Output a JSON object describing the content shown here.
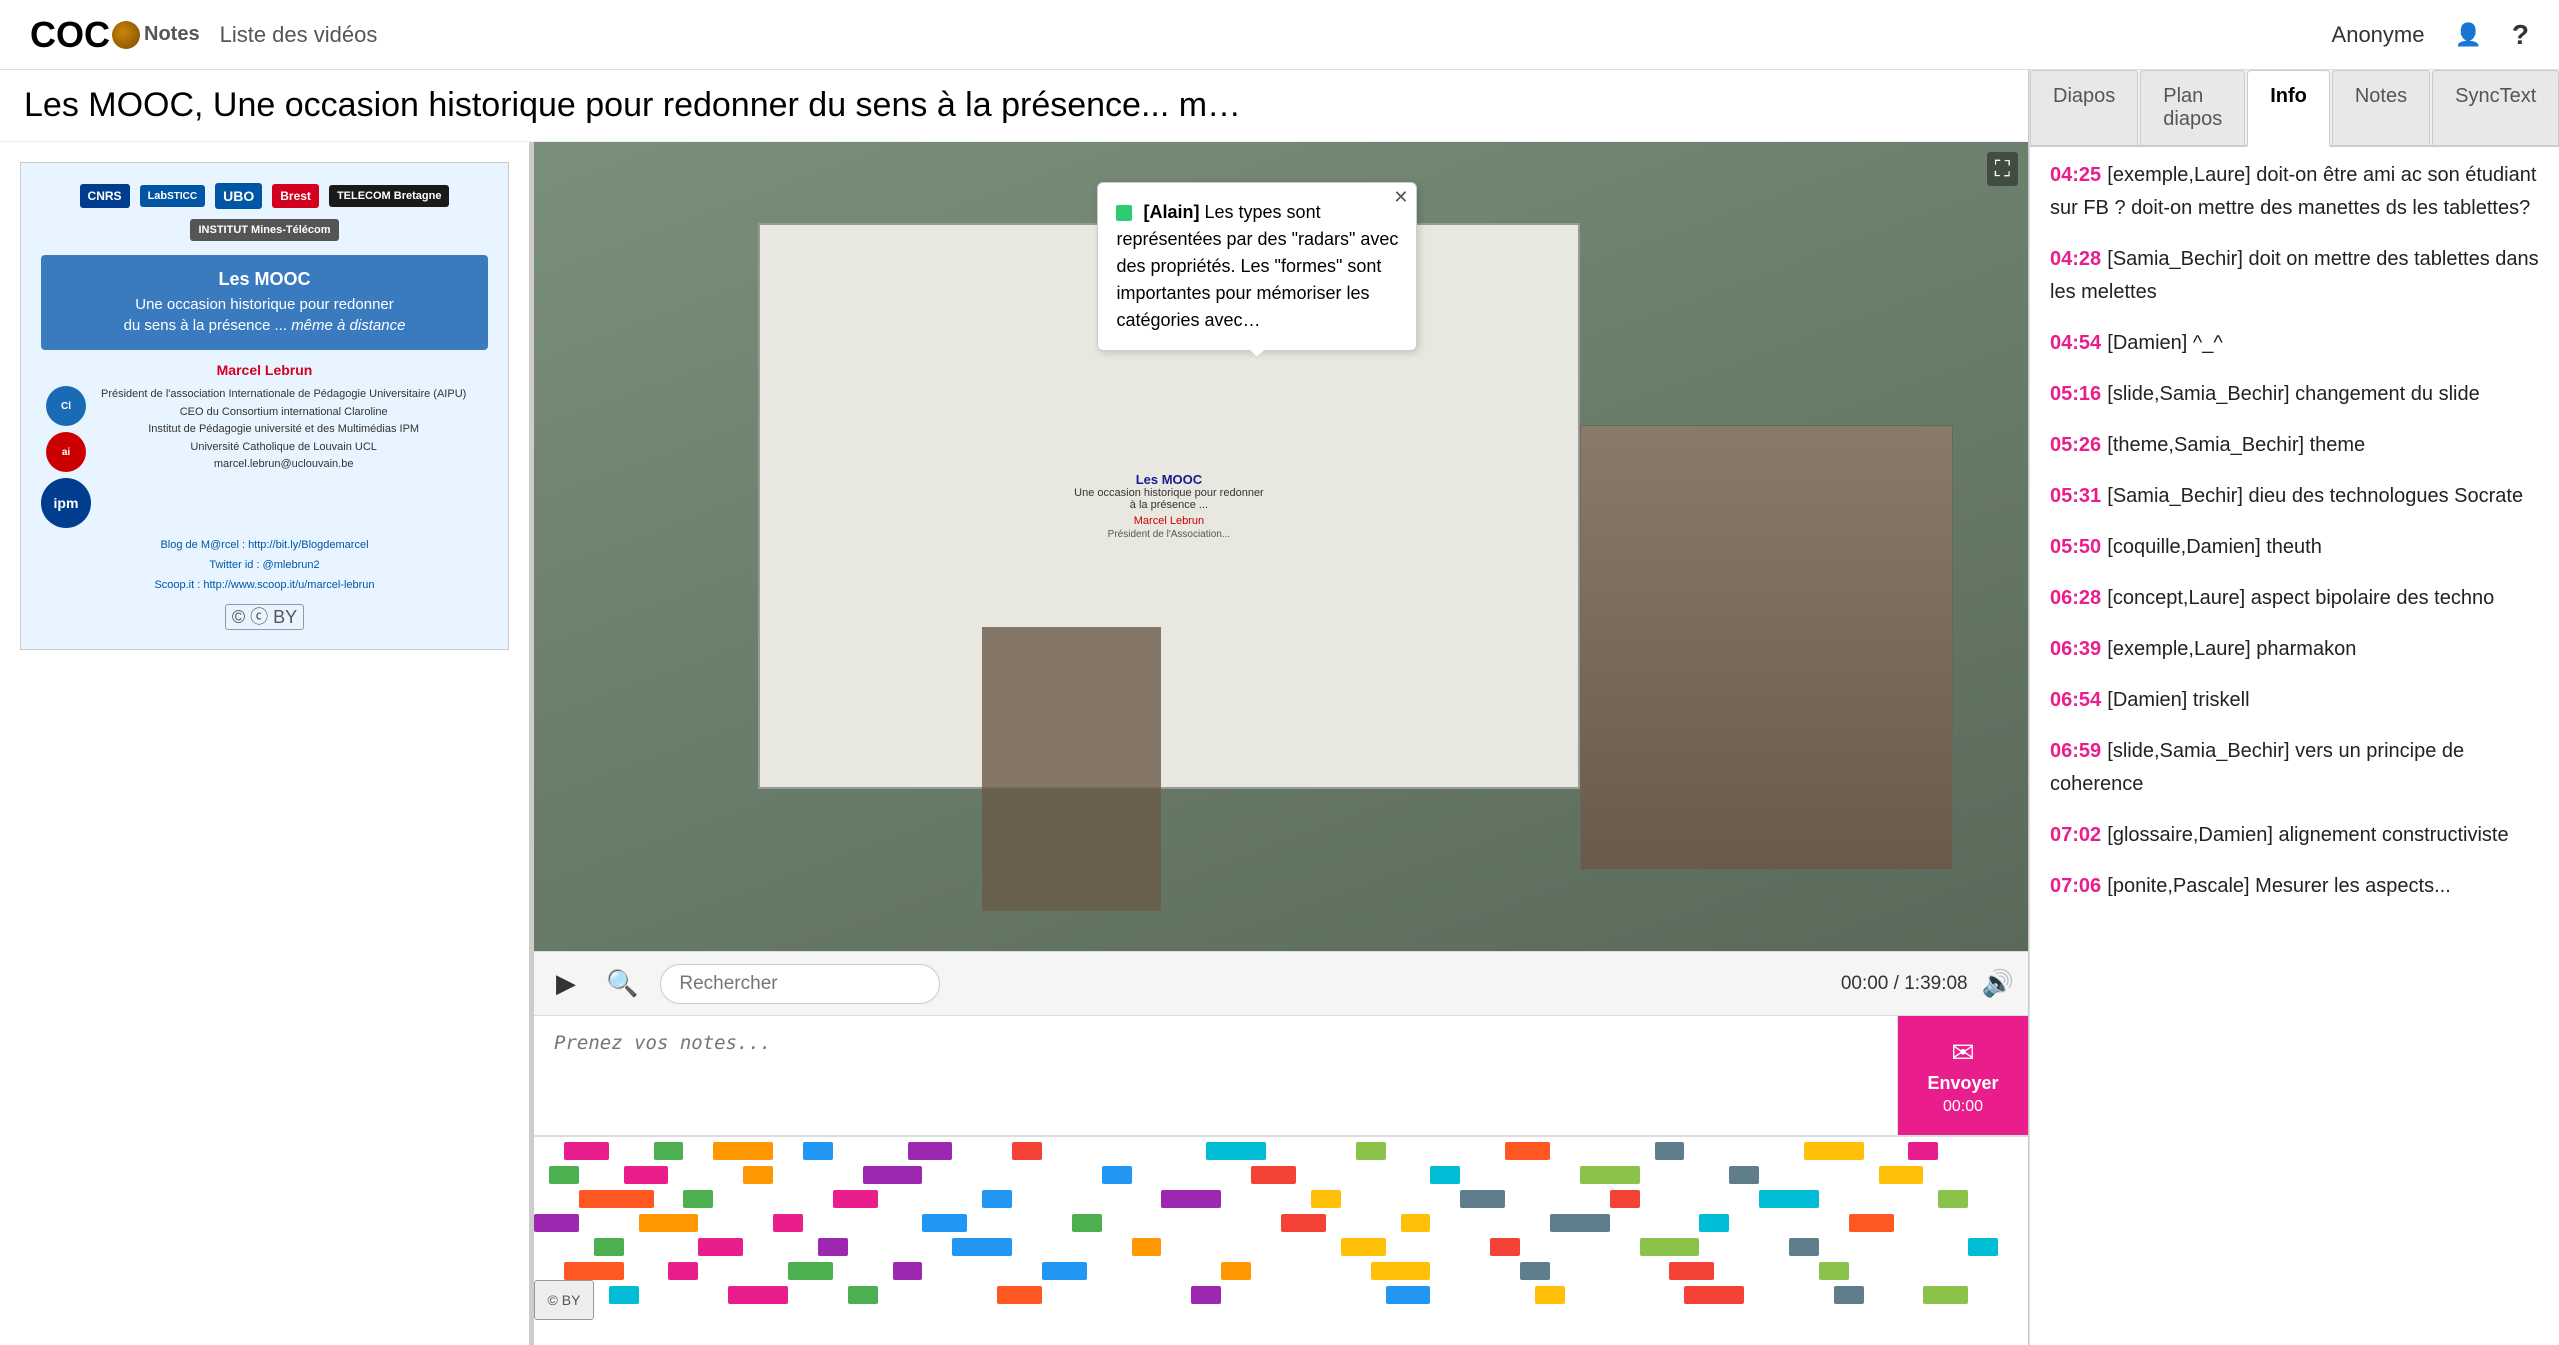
{
  "header": {
    "logo": "COC",
    "logo_notes": "Notes",
    "nav_link": "Liste des vidéos",
    "user": "Anonyme",
    "help": "?"
  },
  "page": {
    "title": "Les MOOC, Une occasion historique pour redonner du sens à la présence... m…"
  },
  "slide": {
    "title_main": "Les MOOC",
    "title_sub": "Une occasion historique pour redonner du sens à la présence ... même à distance",
    "author": "Marcel Lebrun",
    "role1": "Président de l'association Internationale de Pédagogie Universitaire (AIPU)",
    "role2": "CEO du Consortium international Claroline",
    "role3": "Institut de Pédagogie université et des Multimédias IPM",
    "univ": "Université Catholique de Louvain UCL",
    "email": "marcel.lebrun@uclouvain.be",
    "blog_label": "Blog de M@rcel :",
    "blog_url": "http://bit.ly/Blogdemarcel",
    "twitter_label": "Twitter id : @mlebrun2",
    "scoop_label": "Scoop.it :",
    "scoop_url": "http://www.scoop.it/u/marcel-lebrun"
  },
  "video": {
    "time_current": "00:00",
    "time_total": "1:39:08",
    "search_placeholder": "Rechercher"
  },
  "tooltip": {
    "author": "Alain",
    "text": "Les types sont représentées par des \"radars\" avec des propriétés. Les \"formes\" sont importantes pour mémoriser les catégories avec…"
  },
  "notes": {
    "placeholder": "Prenez vos notes...",
    "send_label": "Envoyer",
    "send_time": "00:00"
  },
  "tabs": [
    {
      "id": "diapos",
      "label": "Diapos"
    },
    {
      "id": "plan-diapos",
      "label": "Plan diapos"
    },
    {
      "id": "info",
      "label": "Info",
      "active": true
    },
    {
      "id": "notes",
      "label": "Notes"
    },
    {
      "id": "synctext",
      "label": "SyncText"
    }
  ],
  "comments": [
    {
      "time": "04:25",
      "text": "[exemple,Laure] doit-on être ami ac son étudiant sur FB ? doit-on mettre des manettes ds les tablettes?"
    },
    {
      "time": "04:28",
      "text": "[Samia_Bechir] doit on mettre des tablettes dans les melettes"
    },
    {
      "time": "04:54",
      "text": "[Damien] ^_^"
    },
    {
      "time": "05:16",
      "text": "[slide,Samia_Bechir] changement du slide"
    },
    {
      "time": "05:26",
      "text": "[theme,Samia_Bechir] theme"
    },
    {
      "time": "05:31",
      "text": "[Samia_Bechir] dieu des technologues Socrate"
    },
    {
      "time": "05:50",
      "text": "[coquille,Damien] theuth"
    },
    {
      "time": "06:28",
      "text": "[concept,Laure] aspect bipolaire des techno"
    },
    {
      "time": "06:39",
      "text": "[exemple,Laure] pharmakon"
    },
    {
      "time": "06:54",
      "text": "[Damien] triskell"
    },
    {
      "time": "06:59",
      "text": "[slide,Samia_Bechir] vers un principe de coherence"
    },
    {
      "time": "07:02",
      "text": "[glossaire,Damien] alignement constructiviste"
    },
    {
      "time": "07:06",
      "text": "[ponite,Pascale] Mesurer les aspects..."
    }
  ]
}
